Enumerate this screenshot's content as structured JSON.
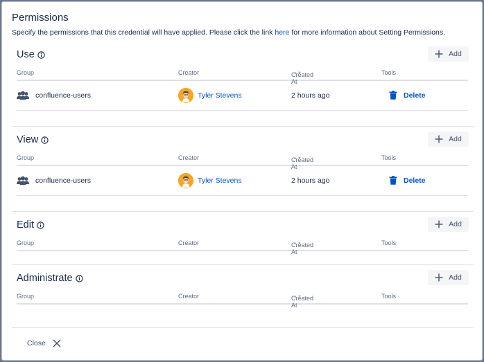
{
  "dialog": {
    "title": "Permissions",
    "desc_pre": "Specify the permissions that this credential will have applied. Please click the link ",
    "desc_link": "here",
    "desc_post": " for more information about Setting Permissions.",
    "close_label": "Close"
  },
  "columns": {
    "group": "Group",
    "creator": "Creator",
    "created_at": "Created At",
    "tools": "Tools"
  },
  "add_label": "Add",
  "delete_label": "Delete",
  "sections": [
    {
      "title": "Use",
      "rows": [
        {
          "group": "confluence-users",
          "creator": "Tyler Stevens",
          "created_at": "2 hours ago"
        }
      ]
    },
    {
      "title": "View",
      "rows": [
        {
          "group": "confluence-users",
          "creator": "Tyler Stevens",
          "created_at": "2 hours ago"
        }
      ]
    },
    {
      "title": "Edit",
      "rows": []
    },
    {
      "title": "Administrate",
      "rows": []
    }
  ],
  "colors": {
    "link": "#0052cc",
    "text": "#172b4d",
    "avatar": "#f5a623"
  }
}
